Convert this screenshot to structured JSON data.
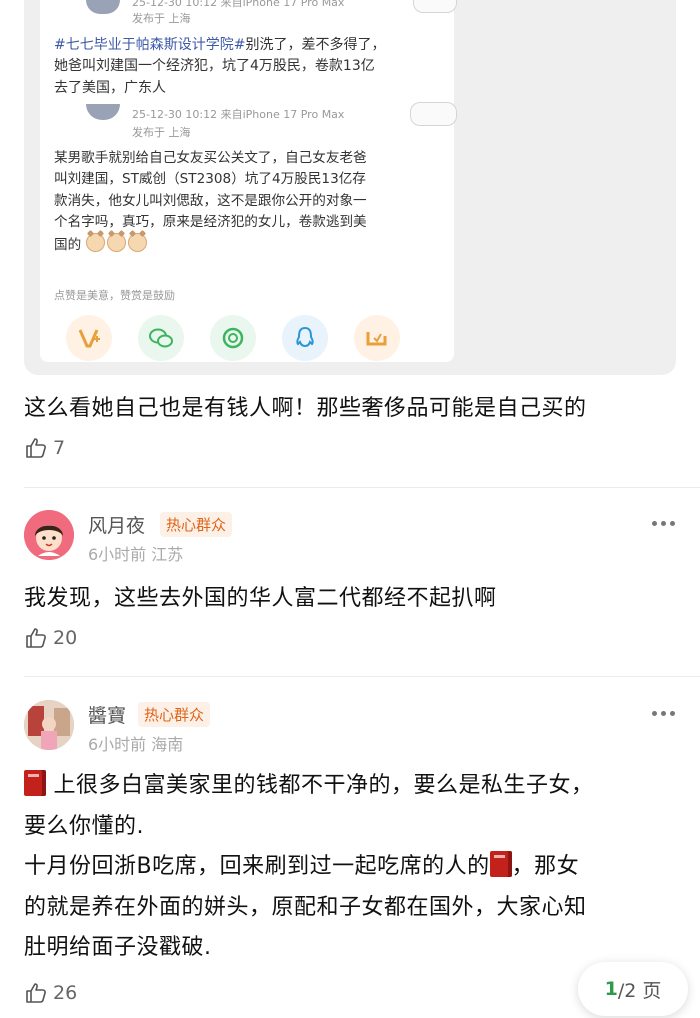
{
  "screenshot": {
    "post1": {
      "meta1": "25-12-30 10:12  来自iPhone 17 Pro Max",
      "location1": "发布于 上海",
      "hashtag": "#七七毕业于帕森斯设计学院#",
      "line1_rest": "别洗了，差不多得了，",
      "line2": "她爸叫刘建国一个经济犯，坑了4万股民，卷款13亿",
      "line3": "去了美国，广东人"
    },
    "post2": {
      "meta": "25-12-30 10:12  来自iPhone 17 Pro Max",
      "location": "发布于 上海",
      "line1": "某男歌手就别给自己女友买公关文了，自己女友老爸",
      "line2": "叫刘建国，ST威创（ST2308）坑了4万股民13亿存",
      "line3": "款消失，他女儿叫刘偲敌，这不是跟你公开的对象一",
      "line4": "个名字吗，真巧，原来是经济犯的女儿，卷款逃到美",
      "line5": "国的"
    },
    "reward_hint": "点赞是美意，赞赏是鼓励",
    "share_icons": [
      "v-plus-icon",
      "wechat-icon",
      "moments-icon",
      "qq-icon",
      "weibo-icon"
    ]
  },
  "comments": [
    {
      "text": "这么看她自己也是有钱人啊！那些奢侈品可能是自己买的",
      "likes": "7"
    },
    {
      "username": "风月夜",
      "badge": "热心群众",
      "time": "6小时前",
      "location": "江苏",
      "text": "我发现，这些去外国的华人富二代都经不起扒啊",
      "likes": "20"
    },
    {
      "username": "醬寶",
      "badge": "热心群众",
      "time": "6小时前",
      "location": "海南",
      "line1": "上很多白富美家里的钱都不干净的，要么是私生子女，",
      "line2": "要么你懂的.",
      "line3a": "十月份回浙B吃席，回来刷到过一起吃席的人的",
      "line3b": "，那女",
      "line4": "的就是养在外面的姘头，原配和子女都在国外，大家心知",
      "line5": "肚明给面子没戳破.",
      "likes": "26"
    }
  ],
  "pager": {
    "current": "1",
    "total": "/2 页"
  },
  "colors": {
    "badge": "#e0651b",
    "accent": "#2e9b4a",
    "hashtag": "#3d5aa8"
  }
}
